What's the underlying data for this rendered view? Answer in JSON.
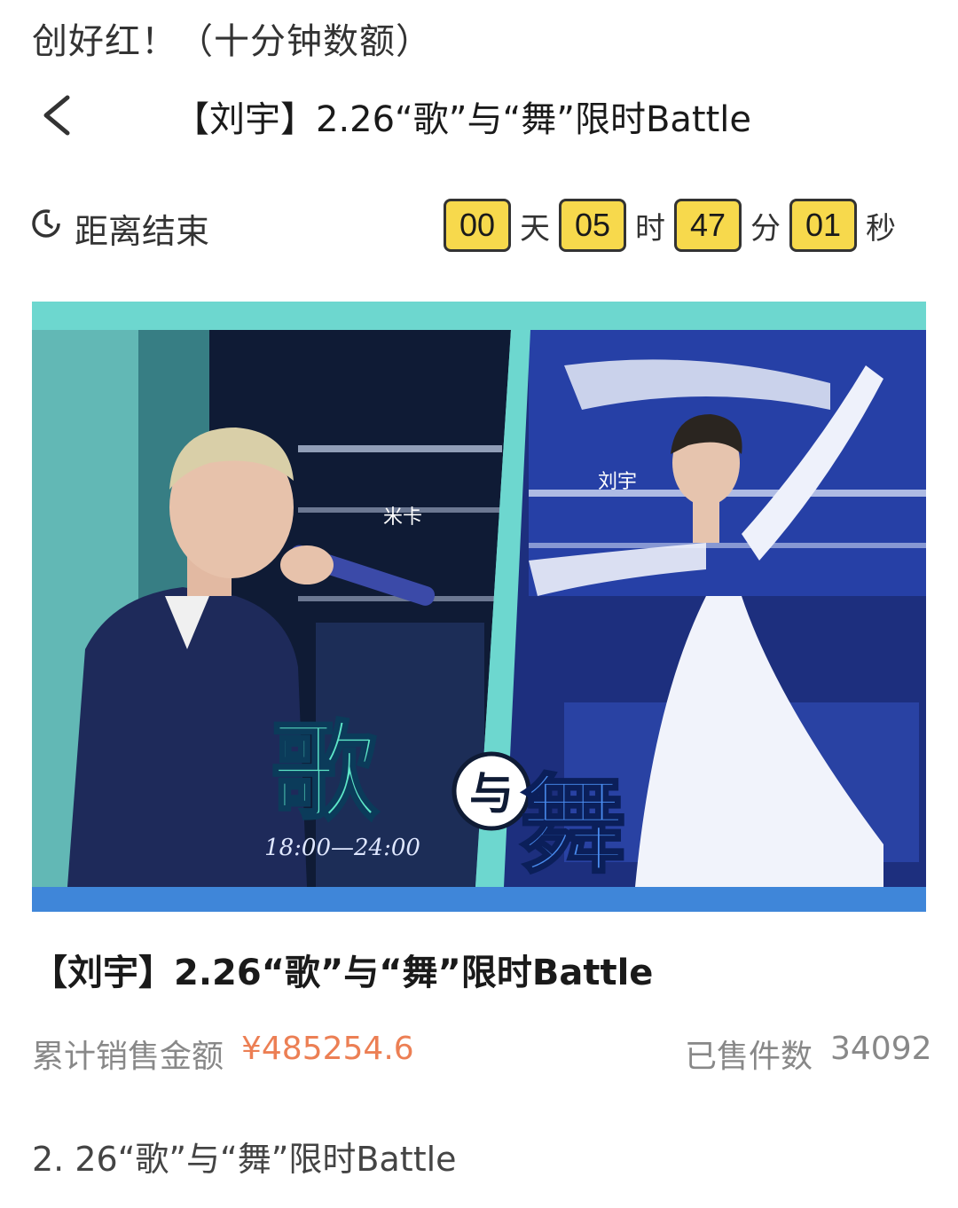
{
  "caption": "创好红！（十分钟数额）",
  "nav": {
    "back_icon": "chevron-left-icon",
    "title": "【刘宇】2.26“歌”与“舞”限时Battle"
  },
  "countdown": {
    "icon": "clock-icon",
    "label": "距离结束",
    "days": "00",
    "days_unit": "天",
    "hours": "05",
    "hours_unit": "时",
    "minutes": "47",
    "minutes_unit": "分",
    "seconds": "01",
    "seconds_unit": "秒",
    "box_color": "#f7d94c"
  },
  "banner": {
    "left_name": "米卡",
    "right_name": "刘宇",
    "left_char": "歌",
    "mid_char": "与",
    "right_char": "舞",
    "time": "18:00—24:00",
    "bg_color": "#6dd7cf",
    "accent_color": "#3f86d9"
  },
  "product": {
    "title": "【刘宇】2.26“歌”与“舞”限时Battle",
    "sales_label": "累计销售金额",
    "sales_value": "¥485254.6",
    "sold_label": "已售件数",
    "sold_value": "34092",
    "price_color": "#ec7f54"
  },
  "description": "2. 26“歌”与“舞”限时Battle"
}
